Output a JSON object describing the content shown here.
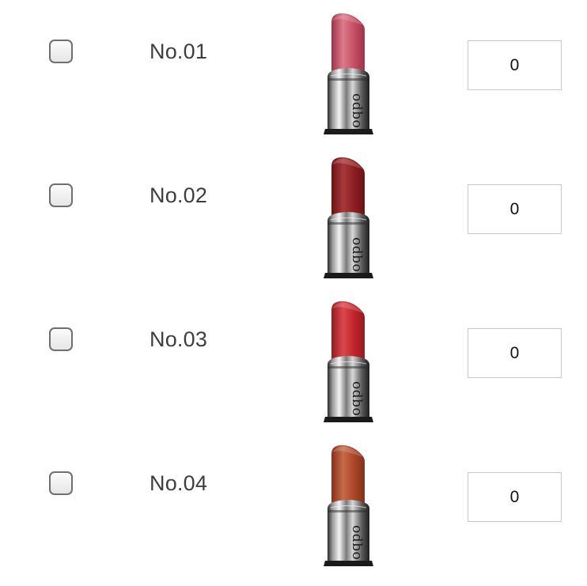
{
  "brand_mark": "odbo",
  "items": [
    {
      "label": "No.01",
      "checked": false,
      "quantity": "0",
      "bullet_color": "#c34d63",
      "bullet_highlight": "#dc7a8b",
      "bullet_shadow": "#9e3348"
    },
    {
      "label": "No.02",
      "checked": false,
      "quantity": "0",
      "bullet_color": "#8b1c20",
      "bullet_highlight": "#a8383b",
      "bullet_shadow": "#6a1216"
    },
    {
      "label": "No.03",
      "checked": false,
      "quantity": "0",
      "bullet_color": "#c0222a",
      "bullet_highlight": "#d9484d",
      "bullet_shadow": "#941a1f"
    },
    {
      "label": "No.04",
      "checked": false,
      "quantity": "0",
      "bullet_color": "#a84425",
      "bullet_highlight": "#c66a48",
      "bullet_shadow": "#82321a"
    }
  ]
}
